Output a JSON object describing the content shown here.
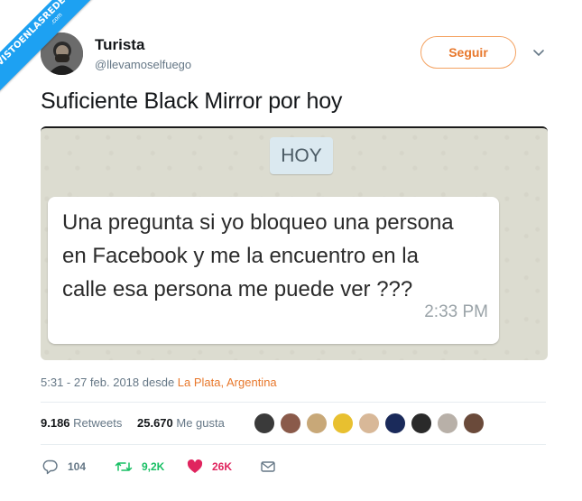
{
  "watermark": {
    "main": "VISTOENLASREDES",
    "sub": ".com"
  },
  "tweet": {
    "display_name": "Turista",
    "handle": "@llevamoselfuego",
    "follow_label": "Seguir",
    "text": "Suficiente Black Mirror por hoy",
    "media": {
      "date_label": "HOY",
      "message": "Una pregunta si yo bloqueo una persona en Facebook y me la encuentro en la calle esa persona me puede ver ???",
      "time": "2:33 PM"
    },
    "timestamp": "5:31 - 27 feb. 2018 desde ",
    "location": "La Plata, Argentina",
    "retweets_count": "9.186",
    "retweets_label": "Retweets",
    "likes_count": "25.670",
    "likes_label": "Me gusta",
    "actions": {
      "replies": "104",
      "retweets": "9,2K",
      "likes": "26K"
    }
  },
  "colors": {
    "accent": "#e8782c",
    "retweet": "#17bf63",
    "like": "#e0245e",
    "watermark": "#1da1f2"
  }
}
